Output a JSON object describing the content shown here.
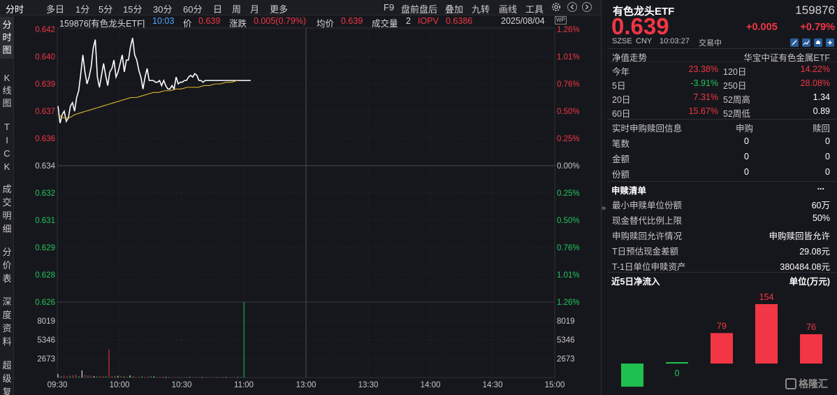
{
  "toolbar": {
    "left_tabs": [
      "分时",
      "多日",
      "1分",
      "5分",
      "15分",
      "30分",
      "60分",
      "日",
      "周",
      "月",
      "更多"
    ],
    "active_tab": "分时",
    "right_items": [
      "F9",
      "盘前盘后",
      "叠加",
      "九转",
      "画线",
      "工具"
    ],
    "settings_icon": "gear-icon",
    "prev_icon": "chevron-left-icon",
    "next_icon": "chevron-right-icon"
  },
  "left_tabs": [
    "分时图",
    "K线图",
    "TICK",
    "成交明细",
    "分价表",
    "深度资料",
    "超级复"
  ],
  "chart_header": {
    "symbol": "159876[有色龙头ETF]",
    "time": "10:03",
    "price_label": "价",
    "price": "0.639",
    "change_label": "涨跌",
    "change": "0.005(0.79%)",
    "avg_label": "均价",
    "avg": "0.639",
    "volume_label": "成交量",
    "volume": "2",
    "iopv_label": "IOPV",
    "iopv": "0.6386",
    "date": "2025/08/04",
    "badge": "WP"
  },
  "chart_data": {
    "type": "line",
    "title": "",
    "xlabel": "",
    "ylabel": "",
    "x_ticks": [
      "09:30",
      "10:00",
      "10:30",
      "11:00",
      "13:00",
      "13:30",
      "14:00",
      "14:30",
      "15:00"
    ],
    "price_ticks": [
      "0.642",
      "0.640",
      "0.639",
      "0.637",
      "0.636",
      "0.634",
      "0.632",
      "0.631",
      "0.629",
      "0.628",
      "0.626"
    ],
    "pct_ticks": [
      "1.26%",
      "1.01%",
      "0.76%",
      "0.50%",
      "0.25%",
      "0.00%",
      "0.25%",
      "0.50%",
      "0.76%",
      "1.01%",
      "1.26%"
    ],
    "ylim": [
      0.626,
      0.642
    ],
    "prev_close": 0.634,
    "volume_ticks": [
      "8019",
      "5346",
      "2673"
    ],
    "volume_max": 10700,
    "series": [
      {
        "values": [
          0.6375,
          0.6365,
          0.637,
          0.6372,
          0.6366,
          0.6368,
          0.6375,
          0.6377,
          0.6372,
          0.638,
          0.6384,
          0.6394,
          0.6405,
          0.6395,
          0.6388,
          0.6392,
          0.6398,
          0.6409,
          0.6414,
          0.6392,
          0.6386,
          0.6393,
          0.64,
          0.6393,
          0.6387,
          0.6395,
          0.6397,
          0.6402,
          0.6392,
          0.6395,
          0.64,
          0.6405,
          0.6395,
          0.6402,
          0.6402,
          0.641,
          0.6415,
          0.6405,
          0.6402,
          0.6396,
          0.6392,
          0.6385,
          0.6392,
          0.6397,
          0.639,
          0.639,
          0.639,
          0.6389,
          0.6389,
          0.639,
          0.6387,
          0.639,
          0.6387,
          0.6385,
          0.6385,
          0.6387,
          0.6385,
          0.6392,
          0.6388,
          0.6389,
          0.6389,
          0.639,
          0.639,
          0.6392,
          0.6393,
          0.6392,
          0.6394,
          0.6393,
          0.639,
          0.639,
          0.6389,
          0.639,
          0.639,
          0.639,
          0.639,
          0.639,
          0.639,
          0.639,
          0.639,
          0.639,
          0.639,
          0.639,
          0.639,
          0.639,
          0.639,
          0.639,
          0.639,
          0.639,
          0.639,
          0.639,
          0.639,
          0.639,
          0.639,
          0.639
        ]
      },
      {
        "values": [
          0.637,
          0.6368,
          0.6368,
          0.637,
          0.6371,
          0.6372,
          0.6373,
          0.6374,
          0.6375,
          0.6376,
          0.6377,
          0.6378,
          0.6379,
          0.638,
          0.638,
          0.6381,
          0.6382,
          0.6383,
          0.6383,
          0.6384,
          0.6384,
          0.6385,
          0.6385,
          0.6386,
          0.6386,
          0.6386,
          0.6387,
          0.6387,
          0.6388,
          0.6388,
          0.6389,
          0.6389,
          0.639
        ]
      }
    ],
    "volume": [
      500,
      200,
      300,
      200,
      250,
      350,
      400,
      200,
      1000,
      400,
      300,
      300,
      200,
      150,
      200,
      200,
      250,
      4000,
      200,
      200,
      250,
      200,
      200,
      150,
      300,
      200,
      100,
      150,
      200,
      100,
      150,
      200,
      150,
      100,
      100,
      150,
      100,
      100,
      80,
      80,
      80,
      80,
      80,
      80,
      80,
      80,
      80,
      80,
      80,
      80,
      80,
      80,
      80,
      80,
      80,
      80,
      80,
      80,
      80,
      80,
      80,
      80,
      10700
    ]
  },
  "quote": {
    "name": "有色龙头ETF",
    "code": "159876",
    "price": "0.639",
    "change": "+0.005",
    "change_pct": "+0.79%",
    "market": "SZSE",
    "currency": "CNY",
    "time": "10:03:27",
    "status": "交易中",
    "icons": [
      "pencil-icon",
      "chart-icon",
      "bell-icon",
      "plus-icon"
    ]
  },
  "nav": {
    "title": "净值走势",
    "index": "华宝中证有色金属ETF",
    "rows": [
      {
        "l1": "今年",
        "v1": "23.38%",
        "c1": "#f23645",
        "l2": "120日",
        "v2": "14.22%",
        "c2": "#f23645"
      },
      {
        "l1": "5日",
        "v1": "-3.91%",
        "c1": "#22c55e",
        "l2": "250日",
        "v2": "28.08%",
        "c2": "#f23645"
      },
      {
        "l1": "20日",
        "v1": "7.31%",
        "c1": "#f23645",
        "l2": "52周高",
        "v2": "1.34",
        "c2": "#ffffff"
      },
      {
        "l1": "60日",
        "v1": "15.67%",
        "c1": "#f23645",
        "l2": "52周低",
        "v2": "0.89",
        "c2": "#ffffff"
      }
    ]
  },
  "subscription": {
    "title": "实时申购赎回信息",
    "col1": "申购",
    "col2": "赎回",
    "rows": [
      {
        "label": "笔数",
        "v1": "0",
        "v2": "0"
      },
      {
        "label": "金额",
        "v1": "0",
        "v2": "0"
      },
      {
        "label": "份额",
        "v1": "0",
        "v2": "0"
      }
    ]
  },
  "redemption_list": {
    "title": "申赎清单",
    "more": "...",
    "rows": [
      {
        "label": "最小申赎单位份额",
        "value": "60万"
      },
      {
        "label": "现金替代比例上限",
        "value": "50%"
      },
      {
        "label": "申购赎回允许情况",
        "value": "申购赎回皆允许"
      },
      {
        "label": "T日预估现金差额",
        "value": "29.08元"
      },
      {
        "label": "T-1日单位申赎资产",
        "value": "380484.08元"
      }
    ]
  },
  "netflow": {
    "title": "近5日净流入",
    "unit": "单位(万元)",
    "values": [
      -60,
      0,
      79,
      154,
      76
    ],
    "labels": [
      "",
      "0",
      "79",
      "154",
      "76"
    ],
    "colors": [
      "#1ec050",
      "#1ec050",
      "#f23645",
      "#f23645",
      "#f23645"
    ],
    "watermark": "格隆汇"
  },
  "collapse_icon": "chevron-right-icon"
}
